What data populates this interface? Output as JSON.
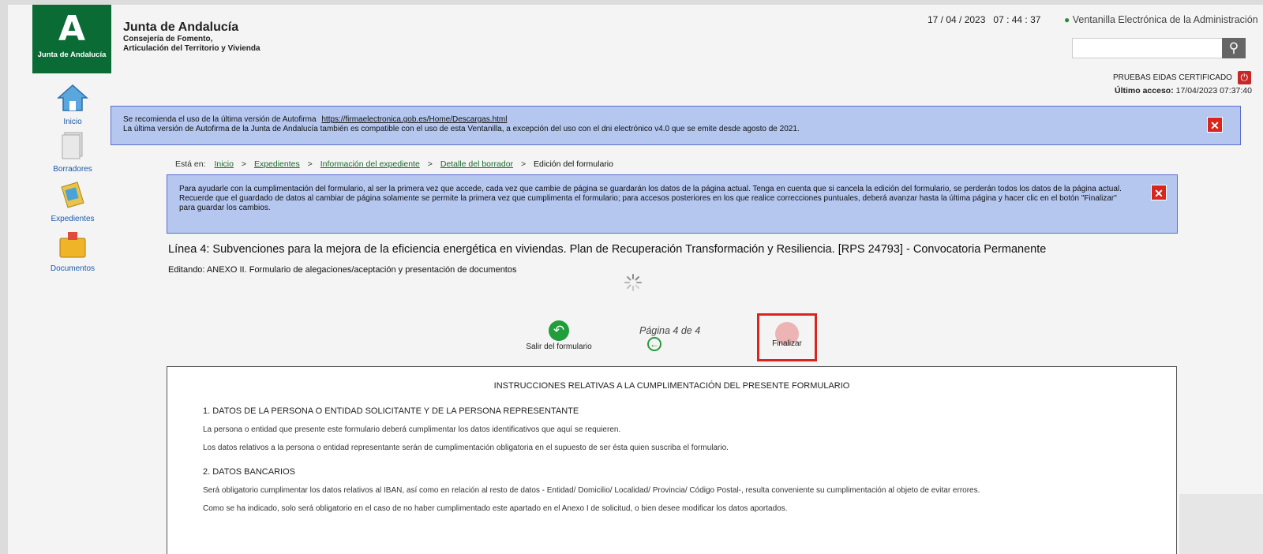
{
  "header": {
    "logo_text": "Junta de Andalucía",
    "org_name": "Junta de Andalucía",
    "org_line1": "Consejería de Fomento,",
    "org_line2": "Articulación del Territorio y Vivienda",
    "datetime": "17 / 04 / 2023   07 : 44 : 37",
    "ventanilla": "Ventanilla Electrónica de la Administración",
    "user": "PRUEBAS EIDAS CERTIFICADO",
    "last_access_label": "Último acceso:",
    "last_access_value": "17/04/2023 07:37:40"
  },
  "sidebar": {
    "items": [
      {
        "label": "Inicio"
      },
      {
        "label": "Borradores"
      },
      {
        "label": "Expedientes"
      },
      {
        "label": "Documentos"
      }
    ]
  },
  "notice1": {
    "line1_text": "Se recomienda el uso de la última versión de Autofirma",
    "line1_link": "https://firmaelectronica.gob.es/Home/Descargas.html",
    "line2": "La última versión de Autofirma de la Junta de Andalucía también es compatible con el uso de esta Ventanilla, a excepción del uso con el dni electrónico v4.0 que se emite desde agosto de 2021."
  },
  "breadcrumb": {
    "prefix": "Está en:",
    "items": [
      "Inicio",
      "Expedientes",
      "Información del expediente",
      "Detalle del borrador"
    ],
    "current": "Edición del formulario"
  },
  "notice2": {
    "p1": "Para ayudarle con la cumplimentación del formulario, al ser la primera vez que accede, cada vez que cambie de página se guardarán los datos de la página actual. Tenga en cuenta que si cancela la edición del formulario, se perderán todos los datos de la página actual.",
    "p2": "Recuerde que el guardado de datos al cambiar de página solamente se permite la primera vez que cumplimenta el formulario; para accesos posteriores en los que realice correcciones puntuales, deberá avanzar hasta la última página y hacer clic en el botón \"Finalizar\" para guardar los cambios."
  },
  "form": {
    "title": "Línea 4: Subvenciones para la mejora de la eficiencia energética en viviendas. Plan de Recuperación Transformación y Resiliencia. [RPS 24793] - Convocatoria Permanente",
    "editing": "Editando: ANEXO II. Formulario de alegaciones/aceptación y presentación de documentos",
    "exit_label": "Salir del formulario",
    "page_info": "Página 4 de 4",
    "finalizar_label": "Finalizar"
  },
  "instructions": {
    "heading": "INSTRUCCIONES RELATIVAS A LA CUMPLIMENTACIÓN DEL PRESENTE FORMULARIO",
    "s1_title": "1. DATOS DE LA PERSONA O ENTIDAD SOLICITANTE Y DE LA PERSONA REPRESENTANTE",
    "s1_p1": "La persona o entidad que presente este formulario deberá cumplimentar los datos identificativos que aquí se requieren.",
    "s1_p2": "Los datos relativos a la persona o entidad representante serán de cumplimentación obligatoria en el supuesto de ser ésta quien suscriba el formulario.",
    "s2_title": "2. DATOS BANCARIOS",
    "s2_p1": "Será obligatorio cumplimentar los datos relativos al IBAN, así como en relación al resto de datos - Entidad/ Domicilio/ Localidad/ Provincia/ Código Postal-, resulta conveniente su cumplimentación al objeto de evitar errores.",
    "s2_p2": "Como se ha indicado, solo será obligatorio en el caso de no haber cumplimentado este apartado en el Anexo I de solicitud, o bien desee modificar los datos aportados."
  }
}
